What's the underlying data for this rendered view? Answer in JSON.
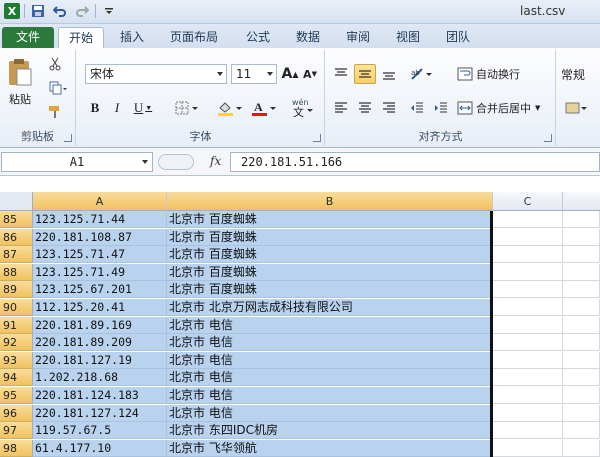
{
  "window": {
    "title": "last.csv"
  },
  "tabs": [
    "文件",
    "开始",
    "插入",
    "页面布局",
    "公式",
    "数据",
    "审阅",
    "视图",
    "团队"
  ],
  "ribbon": {
    "clipboard": {
      "paste_label": "粘贴",
      "group_label": "剪贴板"
    },
    "font": {
      "name": "宋体",
      "size": "11",
      "group_label": "字体",
      "bold": "B",
      "italic": "I",
      "underline": "U",
      "grow": "A",
      "shrink": "A",
      "font_color": "A",
      "phonetic": "文"
    },
    "alignment": {
      "wrap_label": "自动换行",
      "merge_label": "合并后居中",
      "group_label": "对齐方式"
    },
    "number": {
      "format": "常规"
    }
  },
  "formula_bar": {
    "name_box": "A1",
    "fx": "fx",
    "value": "220.181.51.166"
  },
  "columns": [
    "A",
    "B",
    "C"
  ],
  "rows": [
    {
      "num": "85",
      "a": "123.125.71.44",
      "b": "北京市 百度蜘蛛"
    },
    {
      "num": "86",
      "a": "220.181.108.87",
      "b": "北京市 百度蜘蛛"
    },
    {
      "num": "87",
      "a": "123.125.71.47",
      "b": "北京市 百度蜘蛛"
    },
    {
      "num": "88",
      "a": "123.125.71.49",
      "b": "北京市 百度蜘蛛"
    },
    {
      "num": "89",
      "a": "123.125.67.201",
      "b": "北京市 百度蜘蛛"
    },
    {
      "num": "90",
      "a": "112.125.20.41",
      "b": "北京市 北京万网志成科技有限公司"
    },
    {
      "num": "91",
      "a": "220.181.89.169",
      "b": "北京市 电信"
    },
    {
      "num": "92",
      "a": "220.181.89.209",
      "b": "北京市 电信"
    },
    {
      "num": "93",
      "a": "220.181.127.19",
      "b": "北京市 电信"
    },
    {
      "num": "94",
      "a": "1.202.218.68",
      "b": "北京市 电信"
    },
    {
      "num": "95",
      "a": "220.181.124.183",
      "b": "北京市 电信"
    },
    {
      "num": "96",
      "a": "220.181.127.124",
      "b": "北京市 电信"
    },
    {
      "num": "97",
      "a": "119.57.67.5",
      "b": "北京市 东四IDC机房"
    },
    {
      "num": "98",
      "a": "61.4.177.10",
      "b": "北京市 飞华领航"
    }
  ]
}
